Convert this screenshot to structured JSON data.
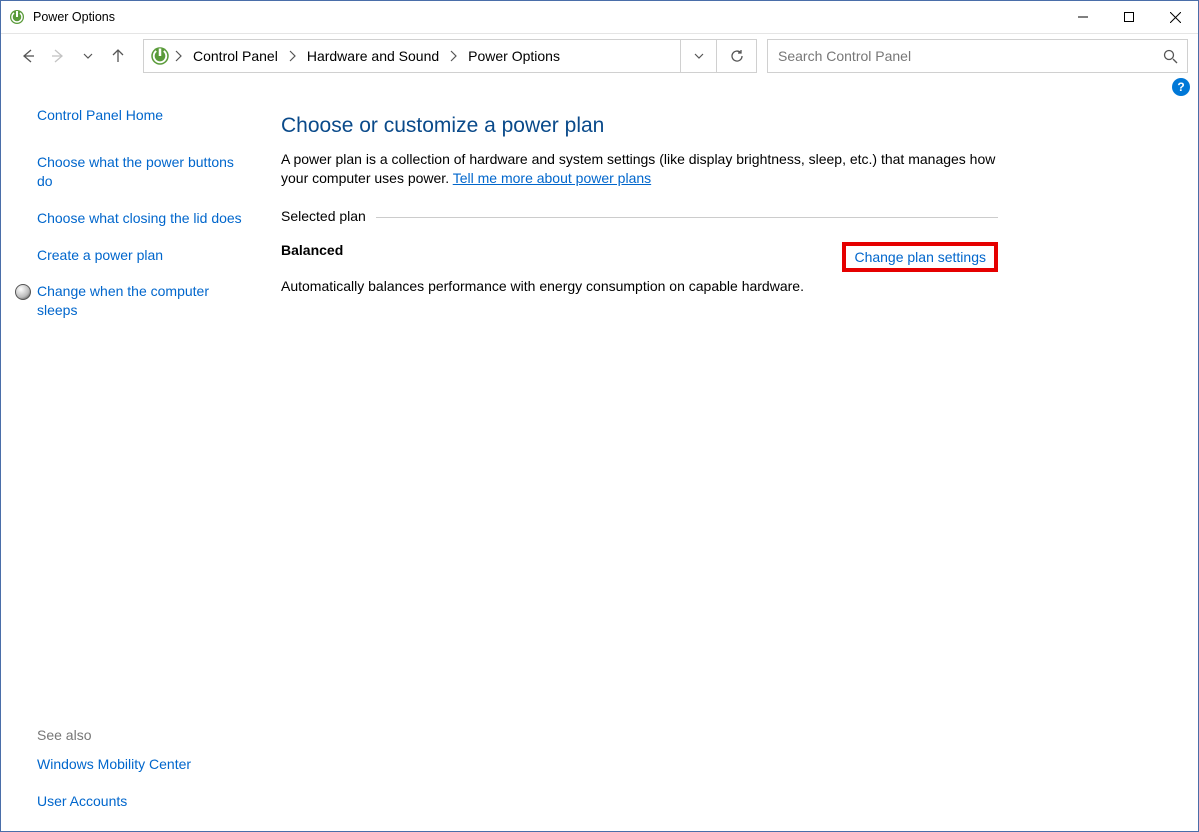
{
  "window": {
    "title": "Power Options"
  },
  "breadcrumbs": {
    "items": [
      "Control Panel",
      "Hardware and Sound",
      "Power Options"
    ]
  },
  "search": {
    "placeholder": "Search Control Panel"
  },
  "sidebar": {
    "home": "Control Panel Home",
    "links": [
      "Choose what the power buttons do",
      "Choose what closing the lid does",
      "Create a power plan",
      "Change when the computer sleeps"
    ],
    "see_also_label": "See also",
    "see_also": [
      "Windows Mobility Center",
      "User Accounts"
    ]
  },
  "main": {
    "heading": "Choose or customize a power plan",
    "description_a": "A power plan is a collection of hardware and system settings (like display brightness, sleep, etc.) that manages how your computer uses power. ",
    "description_link": "Tell me more about power plans",
    "selected_label": "Selected plan",
    "plan": {
      "name": "Balanced",
      "change_link": "Change plan settings",
      "description": "Automatically balances performance with energy consumption on capable hardware."
    }
  }
}
